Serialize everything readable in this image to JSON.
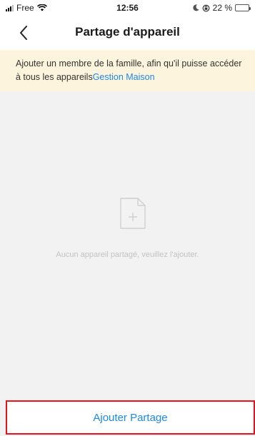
{
  "status_bar": {
    "carrier": "Free",
    "time": "12:56",
    "battery": "22 %",
    "battery_level": 0.22,
    "battery_color": "#f5d300"
  },
  "nav": {
    "title": "Partage d'appareil",
    "back_icon": "chevron-left-icon"
  },
  "banner": {
    "text": "Ajouter un membre de la famille, afin qu'il puisse accéder à tous les appareils",
    "link": "Gestion Maison",
    "link_color": "#1e88e5"
  },
  "empty_state": {
    "icon": "add-document-icon",
    "message": "Aucun appareil partagé, veuillez l'ajouter."
  },
  "footer": {
    "button_label": "Ajouter Partage",
    "highlight_color": "#e8121b"
  }
}
